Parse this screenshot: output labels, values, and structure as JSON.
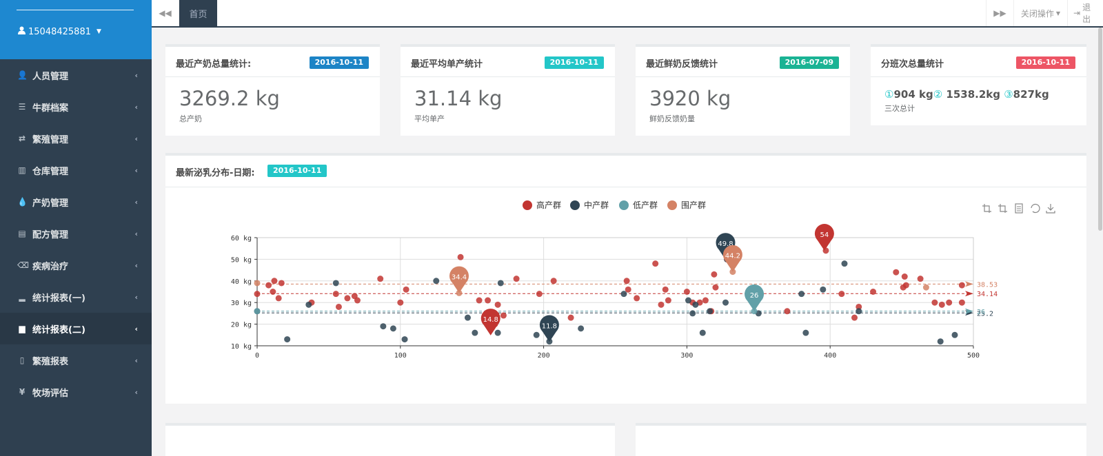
{
  "user": {
    "name": "15048425881"
  },
  "sidebar": {
    "items": [
      {
        "label": "人员管理",
        "icon": "user-icon",
        "glyph": "👤"
      },
      {
        "label": "牛群档案",
        "icon": "server-icon",
        "glyph": "☰"
      },
      {
        "label": "繁殖管理",
        "icon": "retweet-icon",
        "glyph": "⇄"
      },
      {
        "label": "仓库管理",
        "icon": "bar-chart-icon",
        "glyph": "▥"
      },
      {
        "label": "产奶管理",
        "icon": "tint-icon",
        "glyph": "💧"
      },
      {
        "label": "配方管理",
        "icon": "list-icon",
        "glyph": "▤"
      },
      {
        "label": "疾病治疗",
        "icon": "eraser-icon",
        "glyph": "⌫"
      },
      {
        "label": "统计报表(一)",
        "icon": "signal-icon",
        "glyph": "▂"
      },
      {
        "label": "统计报表(二)",
        "icon": "stats-icon",
        "glyph": "▆",
        "active": true
      },
      {
        "label": "繁殖报表",
        "icon": "file-icon",
        "glyph": "▯"
      },
      {
        "label": "牧场评估",
        "icon": "yen-icon",
        "glyph": "¥"
      }
    ]
  },
  "topbar": {
    "home_tab": "首页",
    "close_ops": "关闭操作",
    "logout": "退出"
  },
  "cards": [
    {
      "title": "最近产奶总量统计:",
      "date": "2016-10-11",
      "color": "#1c84c6",
      "value": "3269.2 kg",
      "sub": "总产奶"
    },
    {
      "title": "最近平均单产统计",
      "date": "2016-10-11",
      "color": "#23c6c8",
      "value": "31.14 kg",
      "sub": "平均单产"
    },
    {
      "title": "最近鲜奶反馈统计",
      "date": "2016-07-09",
      "color": "#1ab394",
      "value": "3920 kg",
      "sub": "鲜奶反馈奶量"
    },
    {
      "title": "分班次总量统计",
      "date": "2016-10-11",
      "color": "#ed5565",
      "value": "",
      "sub": "三次总计"
    }
  ],
  "shift": {
    "m1": "①",
    "v1": "904 kg",
    "m2": "②",
    "v2": " 1538.2kg",
    "m3": "③",
    "v3": "827kg"
  },
  "chart_panel": {
    "title": "最新泌乳分布-日期:",
    "date": "2016-10-11"
  },
  "chart_data": {
    "type": "scatter",
    "xlim": [
      0,
      500
    ],
    "ylim": [
      10,
      60
    ],
    "x_ticks": [
      0,
      100,
      200,
      300,
      400,
      500
    ],
    "y_ticks": [
      10,
      20,
      30,
      40,
      50,
      60
    ],
    "y_unit": "kg",
    "legend_position": "top-center",
    "series": [
      {
        "name": "高产群",
        "color": "#c23531",
        "points": [
          [
            0,
            34
          ],
          [
            8,
            38
          ],
          [
            11,
            35
          ],
          [
            12,
            40
          ],
          [
            15,
            32
          ],
          [
            17,
            39
          ],
          [
            38,
            30
          ],
          [
            55,
            34
          ],
          [
            57,
            28
          ],
          [
            63,
            32
          ],
          [
            68,
            33
          ],
          [
            70,
            31
          ],
          [
            86,
            41
          ],
          [
            100,
            30
          ],
          [
            104,
            36
          ],
          [
            142,
            51
          ],
          [
            155,
            31
          ],
          [
            161,
            31
          ],
          [
            166,
            20
          ],
          [
            168,
            29
          ],
          [
            172,
            24
          ],
          [
            181,
            41
          ],
          [
            197,
            34
          ],
          [
            207,
            40
          ],
          [
            219,
            23
          ],
          [
            258,
            40
          ],
          [
            259,
            36
          ],
          [
            265,
            32
          ],
          [
            278,
            48
          ],
          [
            282,
            29
          ],
          [
            285,
            36
          ],
          [
            287,
            31
          ],
          [
            300,
            35
          ],
          [
            304,
            30
          ],
          [
            309,
            30
          ],
          [
            313,
            31
          ],
          [
            317,
            26
          ],
          [
            319,
            43
          ],
          [
            320,
            37
          ],
          [
            328,
            50
          ],
          [
            370,
            26
          ],
          [
            397,
            54
          ],
          [
            408,
            34
          ],
          [
            417,
            23
          ],
          [
            420,
            28
          ],
          [
            430,
            35
          ],
          [
            446,
            44
          ],
          [
            451,
            37
          ],
          [
            452,
            42
          ],
          [
            453,
            38
          ],
          [
            463,
            41
          ],
          [
            473,
            30
          ],
          [
            478,
            29
          ],
          [
            483,
            30
          ],
          [
            492,
            30
          ],
          [
            492,
            38
          ]
        ],
        "pins": [
          {
            "x": 396,
            "y": 54,
            "label": "54"
          },
          {
            "x": 163,
            "y": 14.8,
            "label": "14.8"
          }
        ],
        "markline": {
          "y": 34.14,
          "label": "34.14"
        }
      },
      {
        "name": "中产群",
        "color": "#2f4554",
        "points": [
          [
            0,
            26
          ],
          [
            21,
            13
          ],
          [
            36,
            29
          ],
          [
            55,
            39
          ],
          [
            88,
            19
          ],
          [
            95,
            18
          ],
          [
            103,
            13
          ],
          [
            125,
            40
          ],
          [
            147,
            23
          ],
          [
            152,
            16
          ],
          [
            168,
            16
          ],
          [
            170,
            39
          ],
          [
            195,
            15
          ],
          [
            204,
            12
          ],
          [
            226,
            18
          ],
          [
            256,
            34
          ],
          [
            301,
            31
          ],
          [
            304,
            25
          ],
          [
            306,
            29
          ],
          [
            311,
            16
          ],
          [
            316,
            26
          ],
          [
            327,
            30
          ],
          [
            328,
            50
          ],
          [
            350,
            25
          ],
          [
            380,
            34
          ],
          [
            383,
            16
          ],
          [
            395,
            36
          ],
          [
            410,
            48
          ],
          [
            420,
            26
          ],
          [
            477,
            12
          ],
          [
            487,
            15
          ]
        ],
        "pins": [
          {
            "x": 327,
            "y": 49.8,
            "label": "49.8"
          },
          {
            "x": 204,
            "y": 11.8,
            "label": "11.8"
          }
        ],
        "markline": {
          "y": 25.2,
          "label": "25.2"
        }
      },
      {
        "name": "低产群",
        "color": "#61a0a8",
        "points": [
          [
            0,
            26
          ],
          [
            347,
            26
          ]
        ],
        "pins": [
          {
            "x": 347,
            "y": 26,
            "label": "26"
          }
        ],
        "markline": {
          "y": 26,
          "label": "26"
        }
      },
      {
        "name": "围产群",
        "color": "#d48265",
        "points": [
          [
            0,
            39
          ],
          [
            141,
            34.4
          ],
          [
            332,
            44.2
          ],
          [
            467,
            37
          ]
        ],
        "pins": [
          {
            "x": 141,
            "y": 34.4,
            "label": "34.4"
          },
          {
            "x": 332,
            "y": 44.2,
            "label": "44.2"
          }
        ],
        "markline": {
          "y": 38.53,
          "label": "38.53"
        }
      }
    ]
  }
}
